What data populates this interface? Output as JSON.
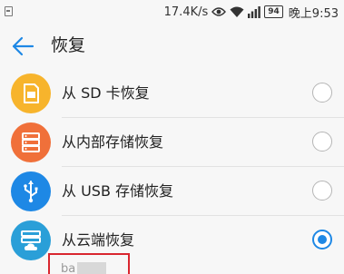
{
  "status_bar": {
    "net_speed": "17.4K/s",
    "battery": "94",
    "time": "晚上9:53",
    "icons": [
      "notification-icon",
      "eye-icon",
      "wifi-icon",
      "signal-icon",
      "battery-icon"
    ]
  },
  "header": {
    "back_icon": "arrow-left-icon",
    "title": "恢复"
  },
  "options": [
    {
      "label": "从 SD 卡恢复",
      "icon": "sd-card-icon",
      "icon_color": "#f7b42c",
      "selected": false
    },
    {
      "label": "从内部存储恢复",
      "icon": "storage-icon",
      "icon_color": "#f0703a",
      "selected": false
    },
    {
      "label": "从 USB 存储恢复",
      "icon": "usb-icon",
      "icon_color": "#1e88e5",
      "selected": false
    },
    {
      "label": "从云端恢复",
      "icon": "cloud-icon",
      "icon_color": "#2a9fd8",
      "selected": true
    }
  ],
  "account": {
    "text": "ba"
  },
  "colors": {
    "accent": "#1e88e5",
    "highlight_border": "#d9262f"
  }
}
